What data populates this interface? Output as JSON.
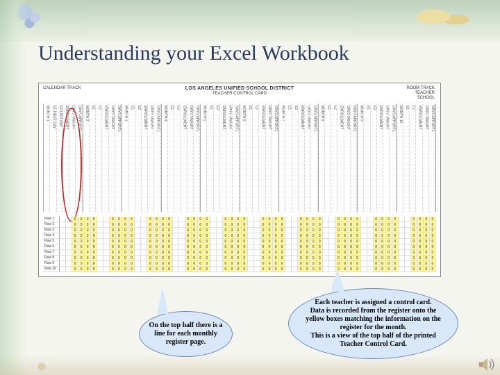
{
  "title": "Understanding your Excel Workbook",
  "spreadsheet": {
    "org_line1": "CALENDAR TRACK",
    "org_line2": "",
    "header_main": "LOS ANGELES UNIFIED SCHOOL DISTRICT",
    "header_sub": "TEACHER CONTROL CARD",
    "right_line1": "ROOM    TRACK",
    "right_line2": "TEACHER",
    "right_line3": "SCHOOL",
    "column_groups": [
      [
        "MONTH 1",
        "E1 FIRST DAY",
        "E2 LAST DAY",
        "ENROLLMENT",
        "DAYS TAUGHT",
        "DAYS APPORTL"
      ],
      [
        "MONTH 2",
        "E1",
        "E2",
        "ENROLLMENT",
        "DAYS TAUGHT",
        "DAYS APPORTL"
      ],
      [
        "MONTH 3",
        "E1",
        "E2",
        "ENROLLMENT",
        "DAYS TAUGHT",
        "DAYS APPORTL"
      ],
      [
        "MONTH 4",
        "E1",
        "E2",
        "ENROLLMENT",
        "DAYS TAUGHT",
        "DAYS APPORTL"
      ],
      [
        "MONTH 5",
        "E1",
        "E2",
        "ENROLLMENT",
        "DAYS TAUGHT",
        "DAYS APPORTL"
      ],
      [
        "MONTH 6",
        "E1",
        "E2",
        "ENROLLMENT",
        "DAYS TAUGHT",
        "DAYS APPORTL"
      ],
      [
        "MONTH 7",
        "E1",
        "E2",
        "ENROLLMENT",
        "DAYS TAUGHT",
        "DAYS APPORTL"
      ],
      [
        "MONTH 8",
        "E1",
        "E2",
        "ENROLLMENT",
        "DAYS TAUGHT",
        "DAYS APPORTL"
      ],
      [
        "MONTH 9",
        "E1",
        "E2",
        "ENROLLMENT",
        "DAYS TAUGHT",
        "DAYS APPORTL"
      ],
      [
        "MONTH 10",
        "E1",
        "E2",
        "ENROLLMENT",
        "DAYS TAUGHT",
        "DAYS APPORTL"
      ]
    ],
    "row_labels": [
      "Row 1",
      "Row 2",
      "Row 3",
      "Row 4",
      "Row 5",
      "Row 6",
      "Row 7",
      "Row 8",
      "Row 9",
      "Row 10"
    ],
    "cell_value_zero": "0",
    "cell_value_blank": ""
  },
  "callout_left": "On the top half there is a line for each monthly register page.",
  "callout_right": "Each teacher is assigned a control card.\nData is recorded from the register onto the yellow boxes matching the information on the register for the month.\nThis is a view of the top half of the printed Teacher Control Card."
}
